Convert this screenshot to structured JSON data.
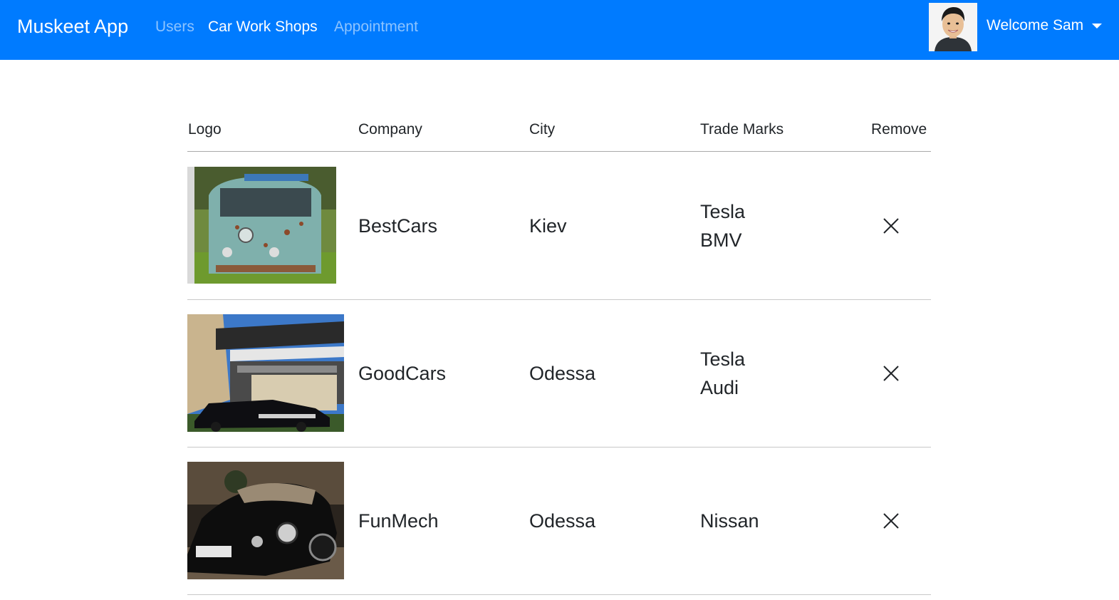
{
  "navbar": {
    "brand": "Muskeet App",
    "links": [
      {
        "label": "Users",
        "active": false
      },
      {
        "label": "Car Work Shops",
        "active": true
      },
      {
        "label": "Appointment",
        "active": false
      }
    ],
    "user_menu_label": "Welcome Sam",
    "colors": {
      "background": "#007bff",
      "active_link": "#ffffff"
    }
  },
  "table": {
    "headers": [
      "Logo",
      "Company",
      "City",
      "Trade Marks",
      "Remove"
    ],
    "rows": [
      {
        "logo": "rusty-vw-bus-photo",
        "company": "BestCars",
        "city": "Kiev",
        "trade_marks": [
          "Tesla",
          "BMV"
        ],
        "remove_icon": "close-icon"
      },
      {
        "logo": "black-sedan-building-photo",
        "company": "GoodCars",
        "city": "Odessa",
        "trade_marks": [
          "Tesla",
          "Audi"
        ],
        "remove_icon": "close-icon"
      },
      {
        "logo": "vintage-citroen-photo",
        "company": "FunMech",
        "city": "Odessa",
        "trade_marks": [
          "Nissan"
        ],
        "remove_icon": "close-icon"
      }
    ]
  }
}
